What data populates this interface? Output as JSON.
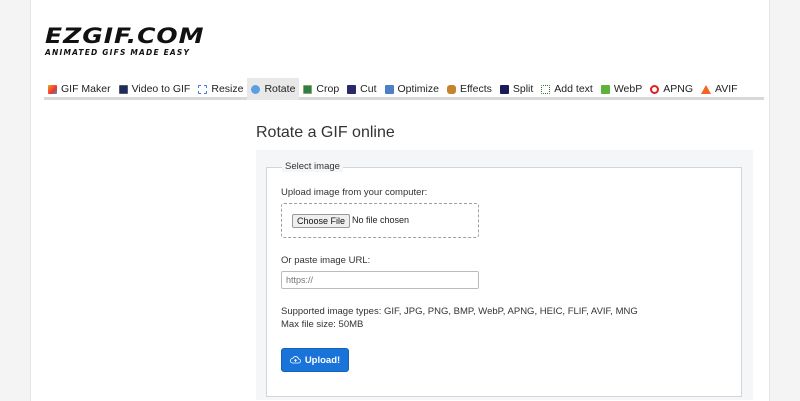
{
  "logo": {
    "title": "EZGIF.COM",
    "tagline": "ANIMATED GIFS MADE EASY"
  },
  "nav": {
    "items": [
      {
        "label": "GIF Maker",
        "icon": "gif-maker-icon"
      },
      {
        "label": "Video to GIF",
        "icon": "video-icon"
      },
      {
        "label": "Resize",
        "icon": "resize-icon"
      },
      {
        "label": "Rotate",
        "icon": "rotate-icon",
        "active": true
      },
      {
        "label": "Crop",
        "icon": "crop-icon"
      },
      {
        "label": "Cut",
        "icon": "cut-icon"
      },
      {
        "label": "Optimize",
        "icon": "optimize-icon"
      },
      {
        "label": "Effects",
        "icon": "effects-icon"
      },
      {
        "label": "Split",
        "icon": "split-icon"
      },
      {
        "label": "Add text",
        "icon": "add-text-icon"
      },
      {
        "label": "WebP",
        "icon": "webp-icon"
      },
      {
        "label": "APNG",
        "icon": "apng-icon"
      },
      {
        "label": "AVIF",
        "icon": "avif-icon"
      }
    ]
  },
  "main": {
    "title": "Rotate a GIF online",
    "form": {
      "legend": "Select image",
      "upload_label": "Upload image from your computer:",
      "choose_file": "Choose File",
      "no_file": "No file chosen",
      "url_label": "Or paste image URL:",
      "url_placeholder": "https://",
      "supported": "Supported image types: GIF, JPG, PNG, BMP, WebP, APNG, HEIC, FLIF, AVIF, MNG",
      "max_size": "Max file size: 50MB",
      "upload_button": "Upload!"
    }
  },
  "colors": {
    "accent": "#1a73d9",
    "active_tab": "#e8e8e8"
  }
}
